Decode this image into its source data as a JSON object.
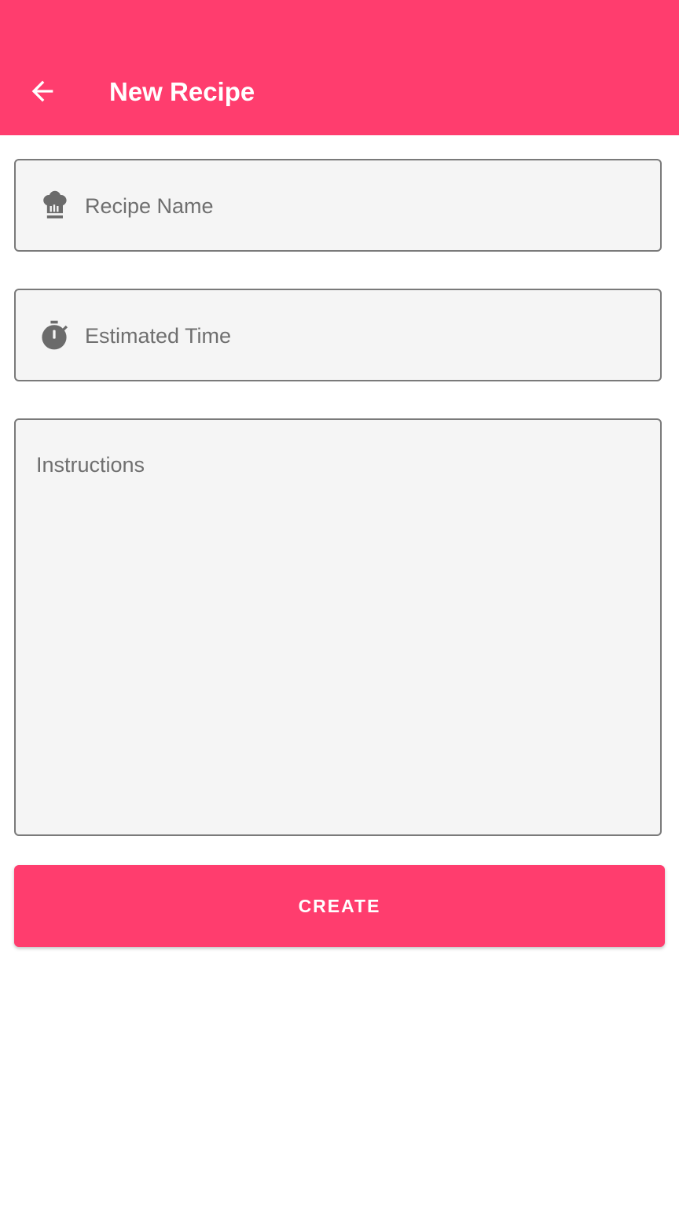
{
  "toolbar": {
    "title": "New Recipe",
    "back_icon": "arrow-back-icon",
    "color": "#ff3d6e"
  },
  "form": {
    "recipe_name": {
      "placeholder": "Recipe Name",
      "value": "",
      "icon": "chef-hat-icon"
    },
    "estimated_time": {
      "placeholder": "Estimated Time",
      "value": "",
      "icon": "stopwatch-icon"
    },
    "instructions": {
      "placeholder": "Instructions",
      "value": ""
    }
  },
  "actions": {
    "create_label": "CREATE"
  }
}
